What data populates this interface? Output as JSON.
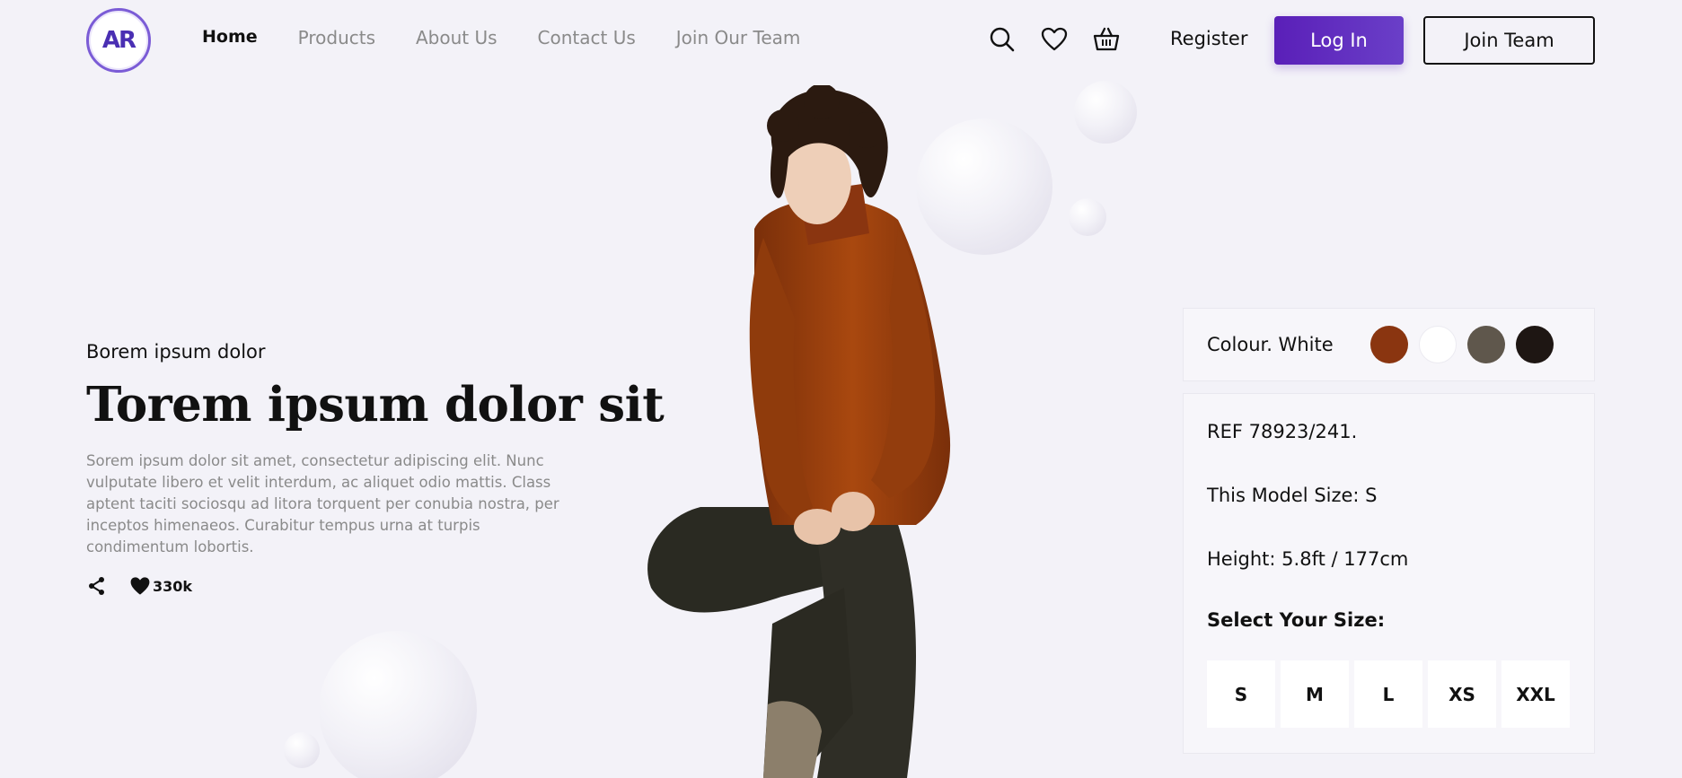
{
  "brand": {
    "logo_text": "AR"
  },
  "nav": {
    "items": [
      {
        "label": "Home",
        "active": true
      },
      {
        "label": "Products"
      },
      {
        "label": "About Us"
      },
      {
        "label": "Contact Us"
      },
      {
        "label": "Join Our Team"
      }
    ]
  },
  "header": {
    "icons": [
      "search-icon",
      "heart-icon",
      "basket-icon"
    ],
    "register_label": "Register",
    "login_label": "Log In",
    "join_label": "Join Team"
  },
  "hero": {
    "kicker": "Borem ipsum dolor",
    "title": "Torem ipsum dolor sit",
    "body": "Sorem ipsum dolor sit amet, consectetur adipiscing elit. Nunc vulputate libero et velit interdum, ac aliquet odio mattis. Class aptent taciti sociosqu ad litora torquent per conubia nostra, per inceptos himenaeos. Curabitur tempus urna at turpis condimentum lobortis.",
    "likes": "330k"
  },
  "product": {
    "colour_label": "Colour. White",
    "colours": [
      "#8a3510",
      "#ffffff",
      "#5f574c",
      "#1e1613"
    ],
    "ref": "REF 78923/241.",
    "model_size": "This Model Size: S",
    "height": "Height: 5.8ft / 177cm",
    "size_title": "Select Your Size:",
    "sizes": [
      "S",
      "M",
      "L",
      "XS",
      "XXL"
    ]
  },
  "colors": {
    "accent": "#5a1fb8",
    "background": "#f3f2f8"
  }
}
